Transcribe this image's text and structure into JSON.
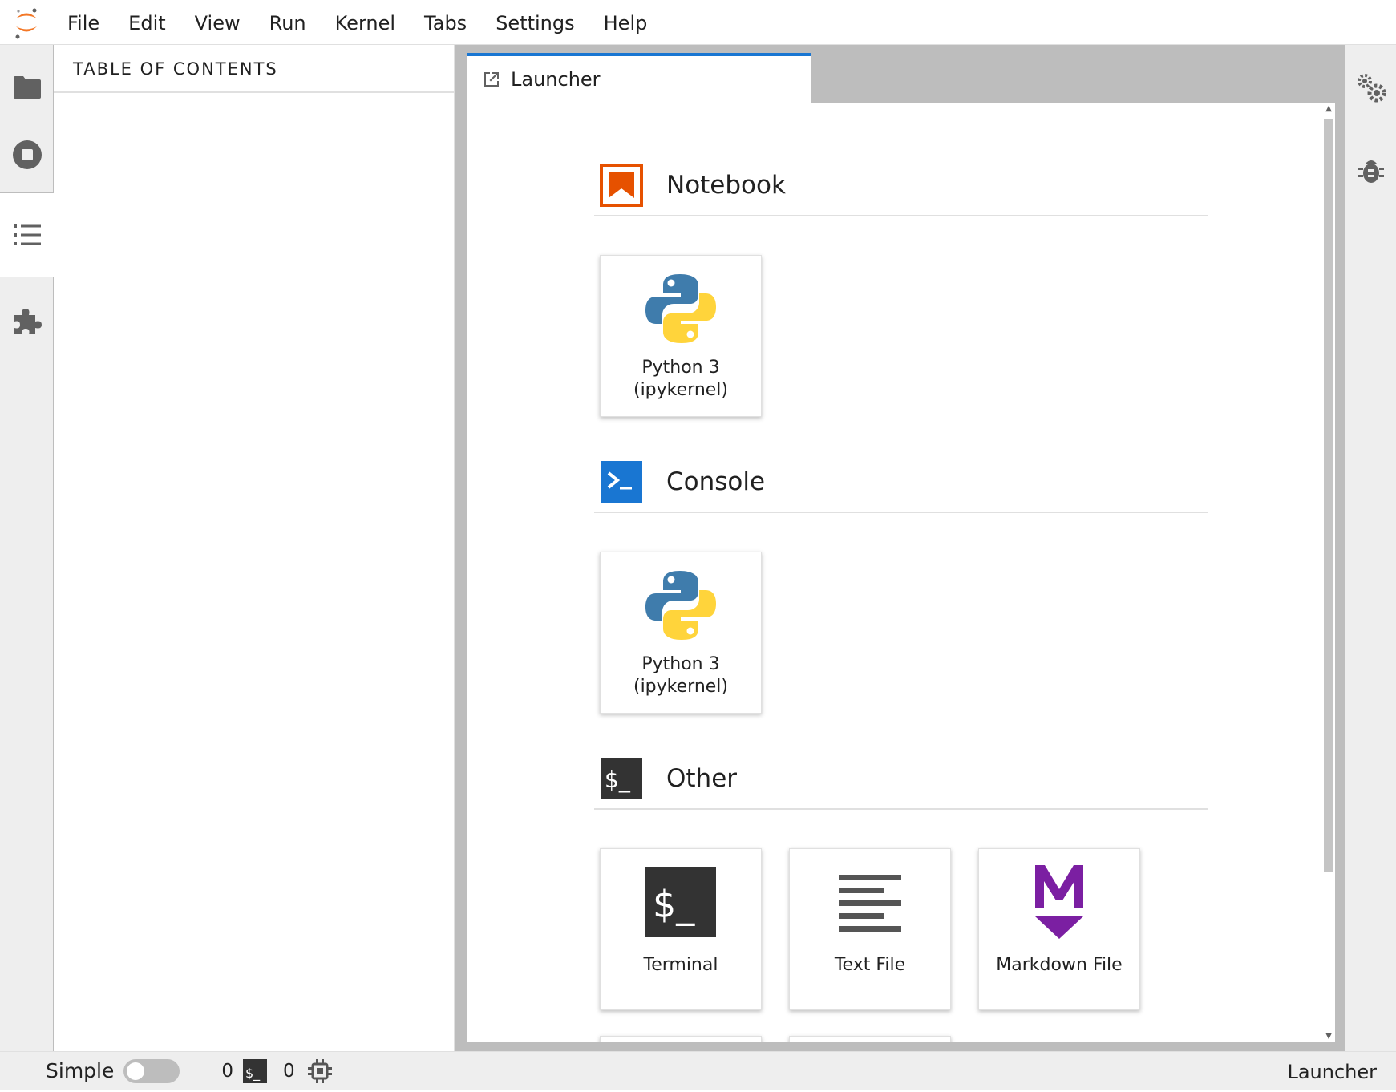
{
  "menubar": {
    "items": [
      "File",
      "Edit",
      "View",
      "Run",
      "Kernel",
      "Tabs",
      "Settings",
      "Help"
    ]
  },
  "left_sidebar": {
    "buttons": [
      "folder-icon",
      "stop-circle-icon",
      "list-icon",
      "puzzle-icon"
    ],
    "active": "list-icon"
  },
  "toc": {
    "title": "TABLE OF CONTENTS"
  },
  "tabs": [
    {
      "label": "Launcher",
      "icon": "launch-icon",
      "active": true
    }
  ],
  "launcher": {
    "sections": [
      {
        "title": "Notebook",
        "icon": "notebook-icon",
        "color": "#e65100",
        "cards": [
          {
            "label_line1": "Python 3",
            "label_line2": "(ipykernel)",
            "icon": "python-icon"
          }
        ]
      },
      {
        "title": "Console",
        "icon": "console-icon",
        "color": "#1976d2",
        "cards": [
          {
            "label_line1": "Python 3",
            "label_line2": "(ipykernel)",
            "icon": "python-icon"
          }
        ]
      },
      {
        "title": "Other",
        "icon": "terminal-icon",
        "color": "#333333",
        "cards": [
          {
            "label": "Terminal",
            "icon": "terminal-icon"
          },
          {
            "label": "Text File",
            "icon": "text-file-icon"
          },
          {
            "label": "Markdown File",
            "icon": "markdown-icon"
          }
        ]
      }
    ]
  },
  "right_sidebar": {
    "buttons": [
      "property-inspector-icon",
      "debugger-icon"
    ]
  },
  "statusbar": {
    "mode_label": "Simple",
    "mode_enabled": false,
    "terminals_count": "0",
    "kernels_count": "0",
    "right_label": "Launcher"
  },
  "colors": {
    "accent": "#1976d2",
    "jupyter_orange": "#f37726",
    "markdown_purple": "#7b1fa2"
  }
}
